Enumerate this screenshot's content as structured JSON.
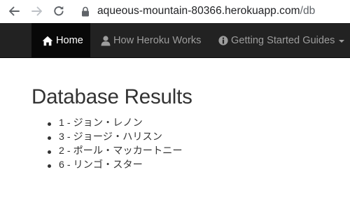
{
  "browser": {
    "url_host": "aqueous-mountain-80366.herokuapp.com",
    "url_path": "/db",
    "back_icon": "arrow-left-icon",
    "forward_icon": "arrow-right-icon",
    "reload_icon": "reload-icon",
    "lock_icon": "lock-icon"
  },
  "navbar": {
    "items": [
      {
        "label": "Home",
        "icon": "home-icon",
        "active": true
      },
      {
        "label": "How Heroku Works",
        "icon": "user-icon",
        "active": false
      },
      {
        "label": "Getting Started Guides",
        "icon": "info-sign-icon",
        "active": false,
        "dropdown": true
      }
    ],
    "background": "#222222",
    "active_background": "#080808",
    "text_color": "#9d9d9d"
  },
  "main": {
    "title": "Database Results",
    "results": [
      "1 - ジョン・レノン",
      "3 - ジョージ・ハリスン",
      "2 - ポール・マッカートニー",
      "6 - リンゴ・スター"
    ]
  }
}
